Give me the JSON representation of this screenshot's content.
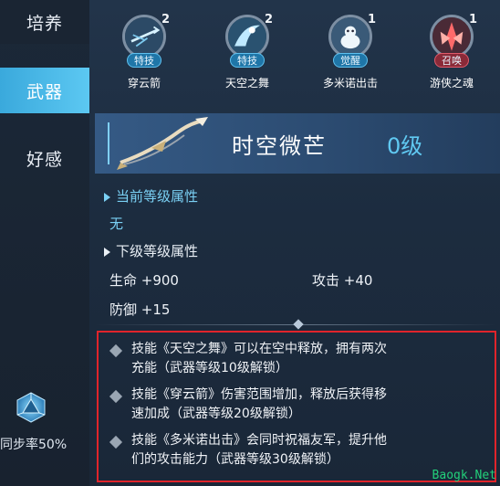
{
  "sidebar": {
    "tabs": [
      {
        "label": "培养",
        "active": false
      },
      {
        "label": "武器",
        "active": true
      },
      {
        "label": "好感",
        "active": false
      }
    ],
    "sync_text": "同步率50%"
  },
  "skills": [
    {
      "name": "穿云箭",
      "tag": "特技",
      "count": "2",
      "icon": "arrow-icon",
      "accent": "#2a8ac4"
    },
    {
      "name": "天空之舞",
      "tag": "特技",
      "count": "2",
      "icon": "dance-icon",
      "accent": "#2a8ac4"
    },
    {
      "name": "多米诺出击",
      "tag": "觉醒",
      "count": "1",
      "icon": "domino-icon",
      "accent": "#2a8ac4"
    },
    {
      "name": "游侠之魂",
      "tag": "召唤",
      "count": "1",
      "icon": "soul-icon",
      "accent": "#c23a4a"
    }
  ],
  "weapon": {
    "name": "时空微芒",
    "level": "0级"
  },
  "current": {
    "title": "当前等级属性",
    "value": "无"
  },
  "next": {
    "title": "下级等级属性",
    "stats": [
      {
        "label": "生命 +900"
      },
      {
        "label": "攻击 +40"
      },
      {
        "label": "防御 +15"
      }
    ]
  },
  "perks": [
    {
      "line1": "技能《天空之舞》可以在空中释放，拥有两次",
      "line2": "充能（武器等级10级解锁）"
    },
    {
      "line1": "技能《穿云箭》伤害范围增加，释放后获得移",
      "line2": "速加成（武器等级20级解锁）"
    },
    {
      "line1": "技能《多米诺出击》会同时祝福友军，提升他",
      "line2": "们的攻击能力（武器等级30级解锁）"
    }
  ],
  "watermark": "Baogk.Net",
  "colors": {
    "accent": "#5cc8f2",
    "highlight_border": "#e0242b",
    "level": "#60c9f2"
  }
}
